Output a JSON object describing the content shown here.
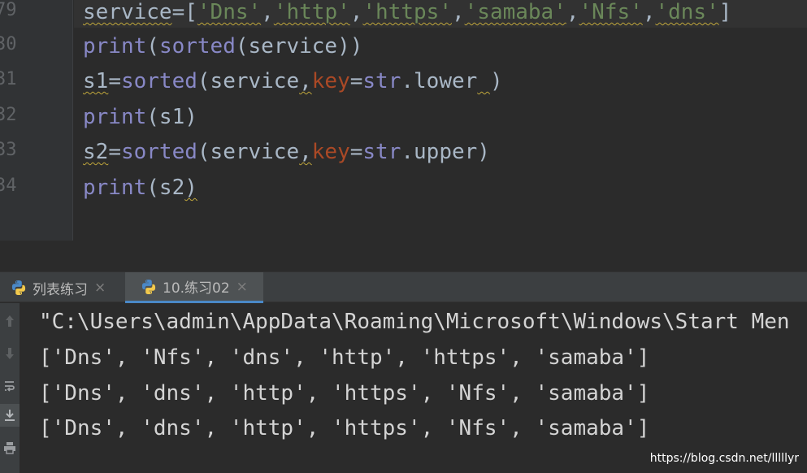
{
  "editor": {
    "line_numbers": [
      "79",
      "30",
      "31",
      "32",
      "33",
      "34"
    ],
    "lines": [
      [
        {
          "t": "service",
          "c": "id",
          "sq": true
        },
        {
          "t": "=",
          "c": "op"
        },
        {
          "t": "[",
          "c": "op"
        },
        {
          "t": "'Dns'",
          "c": "str",
          "sq": true
        },
        {
          "t": ",",
          "c": "op"
        },
        {
          "t": "'http'",
          "c": "str",
          "sq": true
        },
        {
          "t": ",",
          "c": "op"
        },
        {
          "t": "'https'",
          "c": "str",
          "sq": true
        },
        {
          "t": ",",
          "c": "op"
        },
        {
          "t": "'samaba'",
          "c": "str",
          "sq": true
        },
        {
          "t": ",",
          "c": "op"
        },
        {
          "t": "'Nfs'",
          "c": "str",
          "sq": true
        },
        {
          "t": ",",
          "c": "op"
        },
        {
          "t": "'dns'",
          "c": "str",
          "sq": true
        },
        {
          "t": "]",
          "c": "op"
        }
      ],
      [
        {
          "t": "print",
          "c": "builtin"
        },
        {
          "t": "(",
          "c": "op"
        },
        {
          "t": "sorted",
          "c": "builtin"
        },
        {
          "t": "(service))",
          "c": "op"
        }
      ],
      [
        {
          "t": "s1",
          "c": "id",
          "sq": true
        },
        {
          "t": "=",
          "c": "op"
        },
        {
          "t": "sorted",
          "c": "builtin"
        },
        {
          "t": "(service",
          "c": "op"
        },
        {
          "t": ",",
          "c": "op",
          "sq": true
        },
        {
          "t": "key",
          "c": "kw"
        },
        {
          "t": "=",
          "c": "op"
        },
        {
          "t": "str",
          "c": "builtin"
        },
        {
          "t": ".lower",
          "c": "call"
        },
        {
          "t": " ",
          "c": "op",
          "sq": true
        },
        {
          "t": ")",
          "c": "op"
        }
      ],
      [
        {
          "t": "print",
          "c": "builtin"
        },
        {
          "t": "(s1)",
          "c": "op"
        }
      ],
      [
        {
          "t": "s2",
          "c": "id",
          "sq": true
        },
        {
          "t": "=",
          "c": "op"
        },
        {
          "t": "sorted",
          "c": "builtin"
        },
        {
          "t": "(service",
          "c": "op"
        },
        {
          "t": ",",
          "c": "op",
          "sq": true
        },
        {
          "t": "key",
          "c": "kw"
        },
        {
          "t": "=",
          "c": "op"
        },
        {
          "t": "str",
          "c": "builtin"
        },
        {
          "t": ".upper)",
          "c": "call"
        }
      ],
      [
        {
          "t": "print",
          "c": "builtin"
        },
        {
          "t": "(s2",
          "c": "op"
        },
        {
          "t": ")",
          "c": "op",
          "sq": true
        }
      ]
    ]
  },
  "tabs": [
    {
      "label": "列表练习",
      "close": "×",
      "active": false
    },
    {
      "label": "10.练习02",
      "close": "×",
      "active": true
    }
  ],
  "toolbar_icons": [
    "arrow-up-icon",
    "arrow-down-icon",
    "soft-wrap-icon",
    "scroll-to-end-icon",
    "print-icon"
  ],
  "console": {
    "lines": [
      "\"C:\\Users\\admin\\AppData\\Roaming\\Microsoft\\Windows\\Start Men",
      "['Dns', 'Nfs', 'dns', 'http', 'https', 'samaba']",
      "['Dns', 'dns', 'http', 'https', 'Nfs', 'samaba']",
      "['Dns', 'dns', 'http', 'https', 'Nfs', 'samaba']"
    ]
  },
  "watermark": "https://blog.csdn.net/lllllyr",
  "colors": {
    "background": "#2b2b2b",
    "string": "#6a8759",
    "builtin": "#8888c6",
    "keyword_arg": "#aa4926",
    "text": "#a9b7c6"
  }
}
